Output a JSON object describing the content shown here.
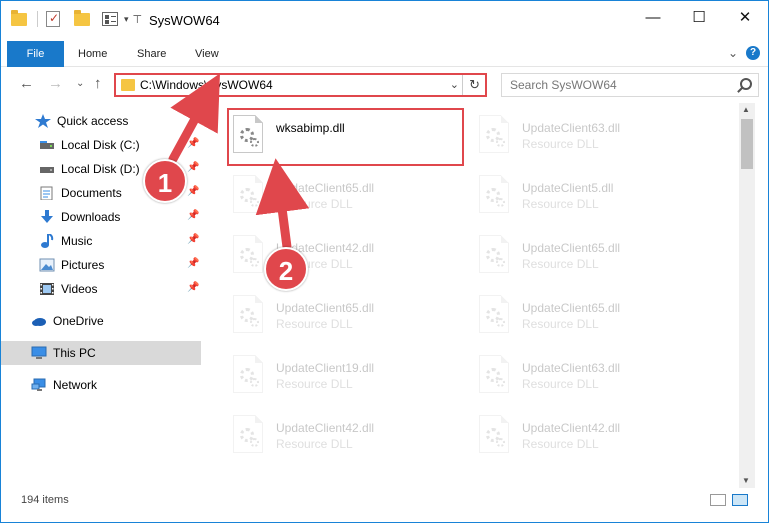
{
  "window": {
    "title": "SysWOW64"
  },
  "window_controls": {
    "minimize": "—",
    "maximize": "☐",
    "close": "✕"
  },
  "ribbon": {
    "tabs": [
      "File",
      "Home",
      "Share",
      "View"
    ],
    "expand": "⌄",
    "help": "?"
  },
  "address": {
    "back": "←",
    "forward": "→",
    "recent": "⌄",
    "up": "↑",
    "path": "C:\\Windows\\SysWOW64",
    "dropdown": "⌄",
    "refresh": "↻"
  },
  "search": {
    "placeholder": "Search SysWOW64"
  },
  "sidebar": {
    "items": [
      {
        "label": "Quick access",
        "icon": "star-icon",
        "pinned": false
      },
      {
        "label": "Local Disk (C:)",
        "icon": "drive-icon",
        "pinned": true
      },
      {
        "label": "Local Disk (D:)",
        "icon": "drive-icon",
        "pinned": true
      },
      {
        "label": "Documents",
        "icon": "documents-icon",
        "pinned": true
      },
      {
        "label": "Downloads",
        "icon": "download-icon",
        "pinned": true
      },
      {
        "label": "Music",
        "icon": "music-icon",
        "pinned": true
      },
      {
        "label": "Pictures",
        "icon": "pictures-icon",
        "pinned": true
      },
      {
        "label": "Videos",
        "icon": "videos-icon",
        "pinned": true
      },
      {
        "label": "OneDrive",
        "icon": "cloud-icon",
        "pinned": false
      },
      {
        "label": "This PC",
        "icon": "computer-icon",
        "pinned": false,
        "selected": true
      },
      {
        "label": "Network",
        "icon": "network-icon",
        "pinned": false
      }
    ],
    "pin_glyph": "📌"
  },
  "files": [
    {
      "name": "wksabimp.dll",
      "type": "",
      "highlighted": true
    },
    {
      "name": "UpdateClient63.dll",
      "type": "Resource DLL"
    },
    {
      "name": "UpdateClient65.dll",
      "type": "Resource DLL"
    },
    {
      "name": "UpdateClient5.dll",
      "type": "Resource DLL"
    },
    {
      "name": "UpdateClient42.dll",
      "type": "Resource DLL"
    },
    {
      "name": "UpdateClient65.dll",
      "type": "Resource DLL"
    },
    {
      "name": "UpdateClient65.dll",
      "type": "Resource DLL"
    },
    {
      "name": "UpdateClient65.dll",
      "type": "Resource DLL"
    },
    {
      "name": "UpdateClient19.dll",
      "type": "Resource DLL"
    },
    {
      "name": "UpdateClient63.dll",
      "type": "Resource DLL"
    },
    {
      "name": "UpdateClient42.dll",
      "type": "Resource DLL"
    },
    {
      "name": "UpdateClient42.dll",
      "type": "Resource DLL"
    }
  ],
  "status": {
    "item_count": "194 items"
  },
  "annotations": {
    "step1": "1",
    "step2": "2",
    "color": "#e0474c"
  },
  "colors": {
    "accent": "#1979ca",
    "highlight": "#e0474c",
    "selected_nav": "#d9d9d9"
  }
}
